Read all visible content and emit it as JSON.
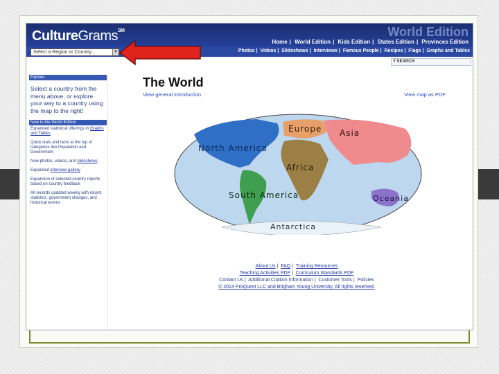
{
  "brand": {
    "name_a": "Culture",
    "name_b": "Grams",
    "mark": "SM"
  },
  "header": {
    "edition_title": "World Edition",
    "editions": [
      "Home",
      "World Edition",
      "Kids Edition",
      "States Edition",
      "Provinces Edition"
    ],
    "region_select": {
      "value": "Select a Region or Country..."
    },
    "sections": [
      "Photos",
      "Videos",
      "Slideshows",
      "Interviews",
      "Famous People",
      "Recipes",
      "Flags",
      "Graphs and Tables"
    ],
    "search_label": "Y SEARCH"
  },
  "sidebar": {
    "header": "Explore",
    "intro": "Select a country from the menu above, or explore your way to a country using the map to the right!",
    "news_header": "New to the World Edition",
    "items": [
      {
        "pre": "Expanded statistical offerings in ",
        "link": "Graphs and Tables",
        "post": ""
      },
      {
        "pre": "Quick stats and facts at the top of categories like Population and Government",
        "link": "",
        "post": ""
      },
      {
        "pre": "New photos, videos, and ",
        "link": "slideshows",
        "post": ""
      },
      {
        "pre": "Expanded ",
        "link": "interview gallery",
        "post": ""
      },
      {
        "pre": "Expansion of selected country reports based on country feedback",
        "link": "",
        "post": ""
      },
      {
        "pre": "All records updated weekly with recent statistics, government changes, and historical events",
        "link": "",
        "post": ""
      }
    ]
  },
  "main": {
    "title": "The World",
    "intro_link": "View general introduction",
    "pdf_link": "View map as PDF",
    "regions": [
      "North America",
      "Europe",
      "Asia",
      "Africa",
      "South America",
      "Oceania",
      "Antarctica"
    ],
    "colors": {
      "ocean": "#bcd7ee",
      "north_america": "#2f6fc6",
      "europe": "#e8a06a",
      "asia": "#ef8a8d",
      "africa": "#9b7f45",
      "south_america": "#3f9e4f",
      "oceania": "#8a73c9",
      "antarctica": "#e9f2f8"
    }
  },
  "footer": {
    "line1": [
      "About Us",
      "FAQ",
      "Training Resources"
    ],
    "line2": [
      "Teaching Activities PDF",
      "Curriculum Standards PDF"
    ],
    "line3": [
      "Contact Us",
      "Additional Citation Information",
      "Customer Tools",
      "Policies"
    ],
    "copyright": "© 2014 ProQuest LLC and Brigham Young University. All rights reserved."
  }
}
